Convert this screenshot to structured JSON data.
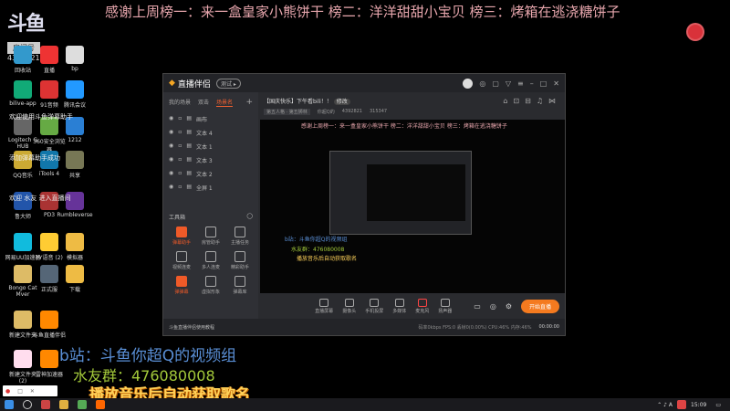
{
  "banner": "感谢上周榜一：来一盒皇家小熊饼干 榜二：洋洋甜甜小宝贝 榜三：烤箱在逃浇糖饼子",
  "logo": {
    "text": "斗鱼",
    "room_label": "房间号",
    "room_number": "4392821"
  },
  "desktop_icons": [
    "回收站",
    "直播",
    "bp",
    "bilive-app",
    "91音频",
    "腾讯会议",
    "Logitech G HUB",
    "360安全浏览器",
    "1212",
    "QQ音乐",
    "iTools 4",
    "共享",
    "鲁大师",
    "PD3",
    "Rumbleverse",
    "网易UU加速器",
    "YY语音 (2)",
    "模拟器",
    "Bongo Cat Mver",
    "正式服",
    "下载",
    "新建文件夹",
    "斗鱼直播伴侣",
    "新建文件夹 (2)",
    "雷神加速器"
  ],
  "chat": [
    "欢迎使用斗鱼弹幕助手",
    "添加弹幕助手成功",
    "欢迎 水友 进入直播间"
  ],
  "app": {
    "name": "直播伴侣",
    "version_badge": "测试 ▸",
    "tabs": [
      "我的场景",
      "双击",
      "场景名"
    ],
    "sources": [
      "画布",
      "文本 4",
      "文本 1",
      "文本 3",
      "文本 2",
      "全屏 1"
    ],
    "tools_label": "工具箱",
    "tools": [
      "弹幕助手",
      "房管助手",
      "主播任务",
      "视频连麦",
      "多人连麦",
      "精彩助手",
      "弹弹幕",
      "虚拟形象",
      "弹幕库"
    ],
    "stream_title": "【国庆快乐】下午看bili！！",
    "edit_label": "修改",
    "category": "第五人格 · 第五狮林",
    "streamer": "你超Q的",
    "room_id": "4392821",
    "hot": "315347",
    "controls": [
      "直播屏幕",
      "摄像头",
      "手机投屏",
      "多媒体",
      "麦克风",
      "扬声器"
    ],
    "start_label": "开始直播",
    "notice": "斗鱼直播伴侣使用教程",
    "stats": "码率0kbps  FPS:0  丢帧0(0.00%)  CPU:46%  内存:46%",
    "timer": "00:00:00"
  },
  "overlay": {
    "bilibili": "b站：斗鱼你超Q的视频组",
    "qq_group": "水友群：476080008",
    "music": "播放音乐后自动获取歌名"
  },
  "taskbar": {
    "time": "15:09"
  }
}
